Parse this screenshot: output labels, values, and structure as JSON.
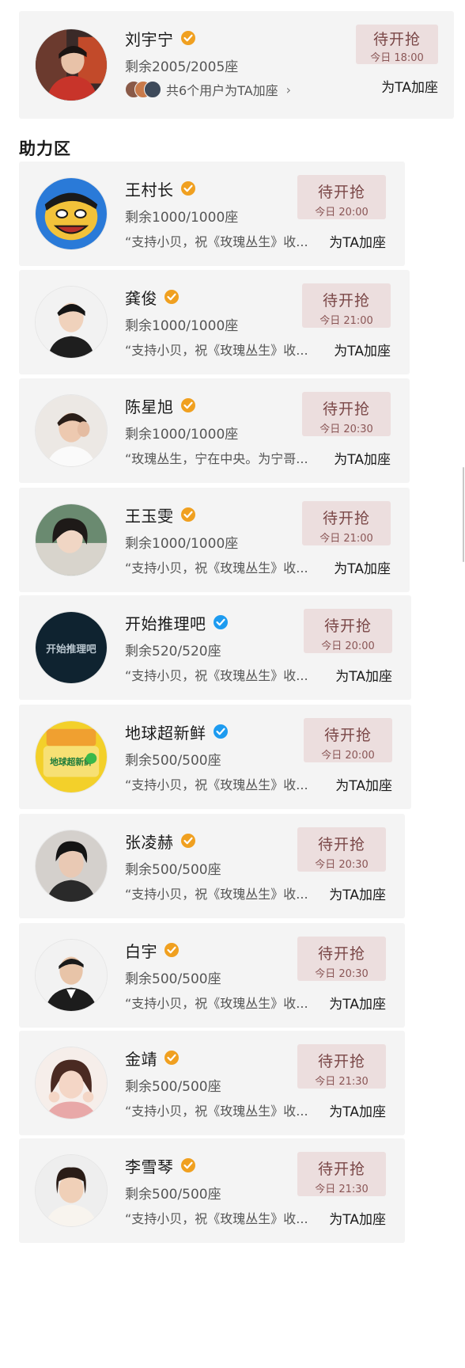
{
  "featured": {
    "name": "刘宇宁",
    "seats": "剩余2005/2005座",
    "helpers_text": "共6个用户为TA加座",
    "chevron": "›",
    "button_label": "待开抢",
    "button_time": "今日 18:00",
    "seat_link": "为TA加座",
    "badge_color": "#f0a020",
    "icon": "chevron-right-icon"
  },
  "section_title": "助力区",
  "cards": [
    {
      "name": "王村长",
      "seats": "剩余1000/1000座",
      "message": "“支持小贝，祝《玫瑰丛生》收...",
      "button_label": "待开抢",
      "button_time": "今日 20:00",
      "seat_link": "为TA加座",
      "badge": "orange"
    },
    {
      "name": "龚俊",
      "seats": "剩余1000/1000座",
      "message": "“支持小贝，祝《玫瑰丛生》收...",
      "button_label": "待开抢",
      "button_time": "今日 21:00",
      "seat_link": "为TA加座",
      "badge": "orange"
    },
    {
      "name": "陈星旭",
      "seats": "剩余1000/1000座",
      "message": "“玫瑰丛生，宁在中央。为宁哥...",
      "button_label": "待开抢",
      "button_time": "今日 20:30",
      "seat_link": "为TA加座",
      "badge": "orange"
    },
    {
      "name": "王玉雯",
      "seats": "剩余1000/1000座",
      "message": "“支持小贝，祝《玫瑰丛生》收...",
      "button_label": "待开抢",
      "button_time": "今日 21:00",
      "seat_link": "为TA加座",
      "badge": "orange"
    },
    {
      "name": "开始推理吧",
      "seats": "剩余520/520座",
      "message": "“支持小贝，祝《玫瑰丛生》收...",
      "button_label": "待开抢",
      "button_time": "今日 20:00",
      "seat_link": "为TA加座",
      "badge": "blue"
    },
    {
      "name": "地球超新鲜",
      "seats": "剩余500/500座",
      "message": "“支持小贝，祝《玫瑰丛生》收...",
      "button_label": "待开抢",
      "button_time": "今日 20:00",
      "seat_link": "为TA加座",
      "badge": "blue"
    },
    {
      "name": "张凌赫",
      "seats": "剩余500/500座",
      "message": "“支持小贝，祝《玫瑰丛生》收...",
      "button_label": "待开抢",
      "button_time": "今日 20:30",
      "seat_link": "为TA加座",
      "badge": "orange"
    },
    {
      "name": "白宇",
      "seats": "剩余500/500座",
      "message": "“支持小贝，祝《玫瑰丛生》收...",
      "button_label": "待开抢",
      "button_time": "今日 20:30",
      "seat_link": "为TA加座",
      "badge": "orange"
    },
    {
      "name": "金靖",
      "seats": "剩余500/500座",
      "message": "“支持小贝，祝《玫瑰丛生》收...",
      "button_label": "待开抢",
      "button_time": "今日 21:30",
      "seat_link": "为TA加座",
      "badge": "orange"
    },
    {
      "name": "李雪琴",
      "seats": "剩余500/500座",
      "message": "“支持小贝，祝《玫瑰丛生》收...",
      "button_label": "待开抢",
      "button_time": "今日 21:30",
      "seat_link": "为TA加座",
      "badge": "orange"
    }
  ],
  "avatar_logos": {
    "kaishi": "开始推理吧",
    "diqiu": "地球超新鲜"
  },
  "colors": {
    "card_bg": "#f4f4f4",
    "button_bg": "#ecdede",
    "button_text": "#7a4747",
    "badge_orange": "#f0a020",
    "badge_blue": "#1d9bf0"
  }
}
